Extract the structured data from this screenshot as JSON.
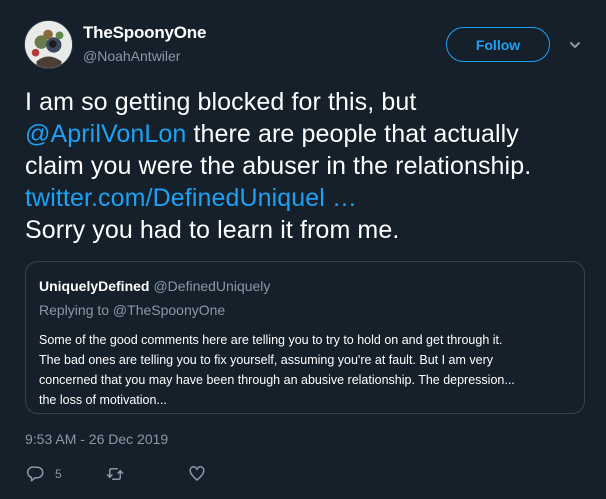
{
  "author": {
    "display_name": "TheSpoonyOne",
    "handle": "@NoahAntwiler"
  },
  "follow_label": "Follow",
  "tweet": {
    "line1": "I am so getting blocked for this, but",
    "mention": "@AprilVonLon",
    "line2_rest": " there are people that actually",
    "line3": "claim you were the abuser in the relationship.",
    "url": "twitter.com/DefinedUniquel …",
    "line5": "Sorry you had to learn it from me."
  },
  "quoted": {
    "display_name": "UniquelyDefined",
    "handle": "@DefinedUniquely",
    "replying_to": "Replying to @TheSpoonyOne",
    "lines": [
      "Some of the good comments here are telling you to try to hold on and get through it.",
      "The bad ones are telling you to fix yourself, assuming you're at fault. But I am very",
      "concerned that you may have been through an abusive relationship. The depression...",
      "the loss of motivation..."
    ]
  },
  "timestamp": "9:53 AM - 26 Dec 2019",
  "actions": {
    "reply_count": "5",
    "reply_icon": "reply-icon",
    "retweet_icon": "retweet-icon",
    "like_icon": "heart-icon"
  },
  "colors": {
    "background": "#15202b",
    "accent": "#1da1f2",
    "muted": "#8899a6",
    "border": "#38444d"
  }
}
